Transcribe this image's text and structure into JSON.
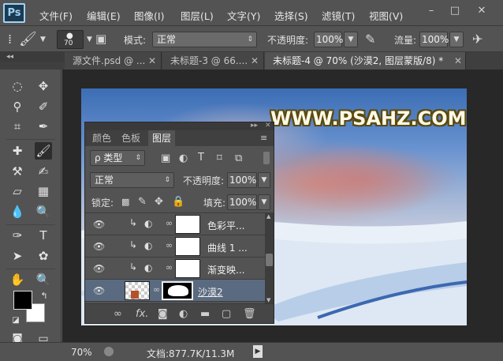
{
  "app": {
    "logo": "Ps"
  },
  "menu": [
    "文件(F)",
    "编辑(E)",
    "图像(I)",
    "图层(L)",
    "文字(Y)",
    "选择(S)",
    "滤镜(T)",
    "视图(V)"
  ],
  "window_controls": [
    "–",
    "□",
    "✕"
  ],
  "options_bar": {
    "brush_size": "70",
    "mode_label": "模式:",
    "mode_value": "正常",
    "opacity_label": "不透明度:",
    "opacity_value": "100%",
    "flow_label": "流量:",
    "flow_value": "100%"
  },
  "tabs": [
    {
      "label": "源文件.psd @ ..."
    },
    {
      "label": "未标题-3 @ 66...."
    },
    {
      "label": "未标题-4 @ 70% (沙漠2, 图层蒙版/8) *"
    }
  ],
  "canvas": {
    "watermark": "WWW.PSAHZ.COM"
  },
  "layers_panel": {
    "tabs": [
      "颜色",
      "色板",
      "图层"
    ],
    "filter_label": "ρ 类型",
    "blend_mode": "正常",
    "opacity_label": "不透明度:",
    "opacity_value": "100%",
    "lock_label": "锁定:",
    "fill_label": "填充:",
    "fill_value": "100%",
    "layers": [
      {
        "name": "色彩平...",
        "kind": "adjustment",
        "visible": true
      },
      {
        "name": "曲线 1 ...",
        "kind": "adjustment",
        "visible": true
      },
      {
        "name": "渐变映...",
        "kind": "adjustment",
        "visible": true
      },
      {
        "name": "沙漠2",
        "kind": "image-with-mask",
        "visible": true,
        "selected": true
      }
    ],
    "bottom_icons": [
      "link-icon",
      "fx-icon",
      "mask-icon",
      "adjustment-icon",
      "folder-icon",
      "new-layer-icon",
      "trash-icon"
    ]
  },
  "status": {
    "zoom": "70%",
    "doc_info": "文档:877.7K/11.3M"
  },
  "colors": {
    "foreground": "#000000",
    "background": "#ffffff",
    "ui_bg": "#535353"
  }
}
